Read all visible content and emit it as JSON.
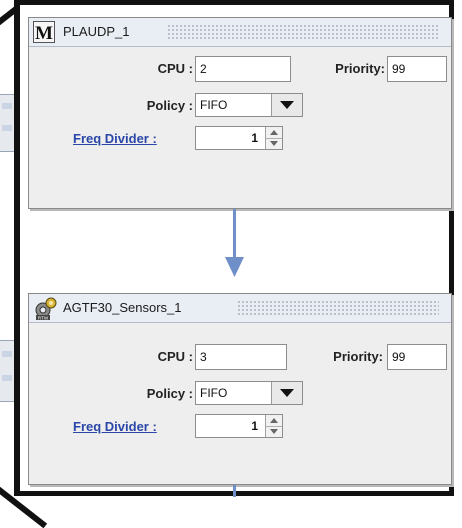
{
  "blocks": [
    {
      "title": "PLAUDP_1",
      "icon": "m-letter-icon",
      "cpu_label": "CPU :",
      "cpu_value": "2",
      "priority_label": "Priority:",
      "priority_value": "99",
      "policy_label": "Policy :",
      "policy_value": "FIFO",
      "freq_label": "Freq Divider :",
      "freq_value": "1"
    },
    {
      "title": "AGTF30_Sensors_1",
      "icon": "gears-icon",
      "cpu_label": "CPU :",
      "cpu_value": "3",
      "priority_label": "Priority:",
      "priority_value": "99",
      "policy_label": "Policy :",
      "policy_value": "FIFO",
      "freq_label": "Freq Divider :",
      "freq_value": "1"
    }
  ],
  "colors": {
    "connector": "#6f8fc8",
    "link": "#2a46a8",
    "frame": "#111111"
  }
}
